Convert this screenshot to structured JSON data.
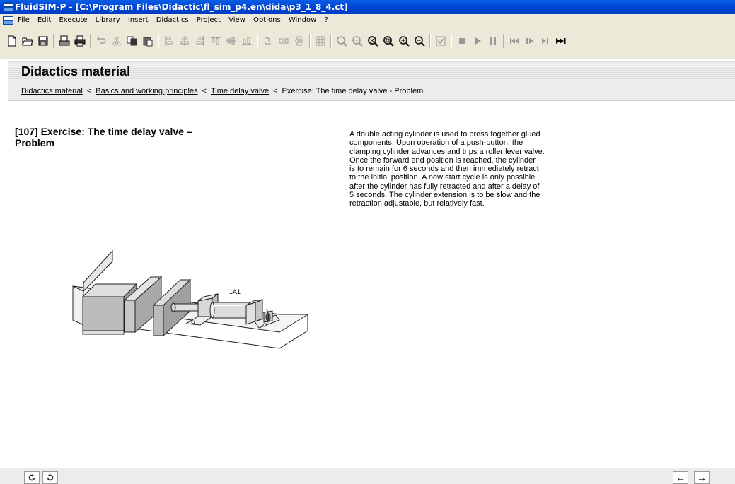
{
  "window": {
    "title": "FluidSIM-P - [C:\\Program Files\\Didactic\\fl_sim_p4.en\\dida\\p3_1_8_4.ct]"
  },
  "menu": [
    "File",
    "Edit",
    "Execute",
    "Library",
    "Insert",
    "Didactics",
    "Project",
    "View",
    "Options",
    "Window",
    "?"
  ],
  "header": {
    "title": "Didactics material"
  },
  "breadcrumb": {
    "items": [
      "Didactics material",
      "Basics and working principles",
      "Time delay valve"
    ],
    "current": "Exercise: The time delay valve - Problem",
    "separator": "<"
  },
  "exercise": {
    "title_line1": "[107]  Exercise: The time delay valve –",
    "title_line2": "Problem",
    "description_lines": [
      "A double acting cylinder is used to press together glued",
      "components. Upon operation of a push-button, the",
      "clamping cylinder advances and trips a roller lever valve.",
      "Once the forward end position is reached, the cylinder",
      "is to remain for 6 seconds and then immediately retract",
      "to the initial position. A new start cycle is only possible",
      "after the cylinder has fully retracted and after a delay of",
      "5 seconds. The cylinder extension is to be slow and the",
      "retraction adjustable, but relatively fast."
    ],
    "figure_label": "1A1"
  },
  "nav": {
    "back_glyph": "←",
    "forward_glyph": "→"
  },
  "colors": {
    "titlebar": "#0046d5",
    "chrome": "#ece9d8",
    "panel": "#ececec"
  }
}
